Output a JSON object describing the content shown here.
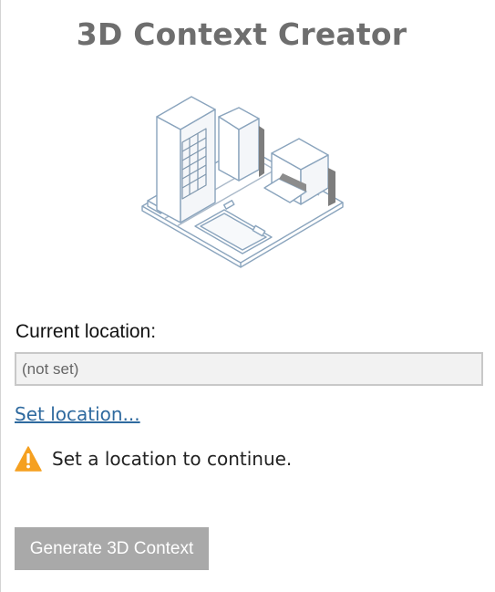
{
  "header": {
    "title": "3D Context Creator"
  },
  "illustration": {
    "icon": "city-block-isometric-icon"
  },
  "location": {
    "label": "Current location:",
    "value": "(not set)"
  },
  "set_location_link": "Set location...",
  "warning": {
    "icon": "warning-triangle-icon",
    "text": "Set a location to continue."
  },
  "generate_button": {
    "label": "Generate 3D Context",
    "enabled": false
  },
  "colors": {
    "title": "#6e6e6e",
    "link": "#2f6a9f",
    "warning": "#f5a020",
    "button_disabled": "#a9a9a9",
    "field_bg": "#f2f2f2"
  }
}
